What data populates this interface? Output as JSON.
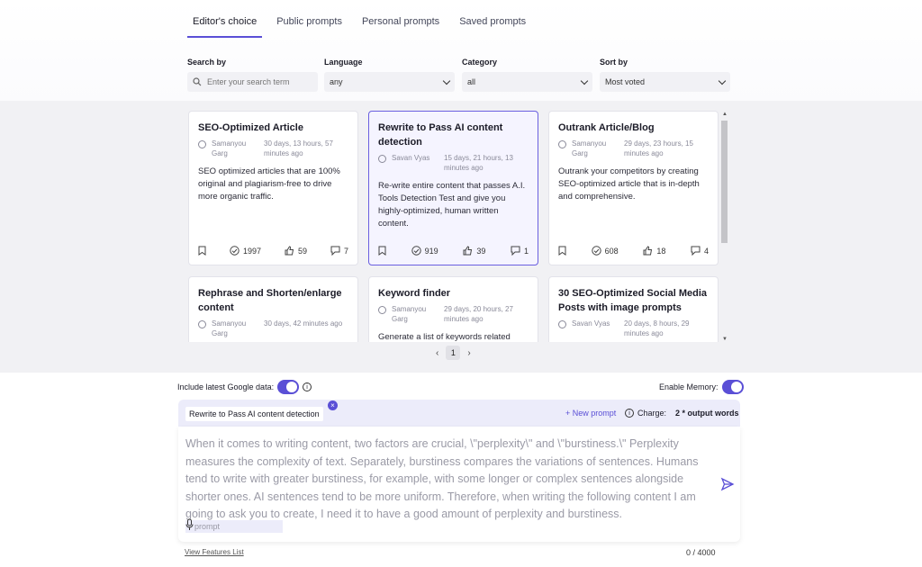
{
  "tabs": [
    {
      "label": "Editor's choice",
      "active": true
    },
    {
      "label": "Public prompts",
      "active": false
    },
    {
      "label": "Personal prompts",
      "active": false
    },
    {
      "label": "Saved prompts",
      "active": false
    }
  ],
  "filters": {
    "search": {
      "label": "Search by",
      "placeholder": "Enter your search term"
    },
    "language": {
      "label": "Language",
      "value": "any"
    },
    "category": {
      "label": "Category",
      "value": "all"
    },
    "sort": {
      "label": "Sort by",
      "value": "Most voted"
    }
  },
  "cards": [
    {
      "title": "SEO-Optimized Article",
      "author": "Samanyou Garg",
      "time": "30 days, 13 hours, 57 minutes ago",
      "description": "SEO optimized articles that are 100% original and plagiarism-free to drive more organic traffic.",
      "views": "1997",
      "likes": "59",
      "comments": "7",
      "selected": false
    },
    {
      "title": "Rewrite to Pass AI content detection",
      "author": "Savan Vyas",
      "time": "15 days, 21 hours, 13 minutes ago",
      "description": "Re-write entire content that passes A.I. Tools Detection Test and give you highly-optimized, human written content.",
      "views": "919",
      "likes": "39",
      "comments": "1",
      "selected": true
    },
    {
      "title": "Outrank Article/Blog",
      "author": "Samanyou Garg",
      "time": "29 days, 23 hours, 15 minutes ago",
      "description": "Outrank your competitors by creating SEO-optimized article that is in-depth and comprehensive.",
      "views": "608",
      "likes": "18",
      "comments": "4",
      "selected": false
    },
    {
      "title": "Rephrase and Shorten/enlarge content",
      "author": "Samanyou Garg",
      "time": "30 days, 42 minutes ago",
      "description": "",
      "views": "",
      "likes": "",
      "comments": "",
      "selected": false
    },
    {
      "title": "Keyword finder",
      "author": "Samanyou Garg",
      "time": "29 days, 20 hours, 27 minutes ago",
      "description": "Generate a list of keywords related",
      "views": "",
      "likes": "",
      "comments": "",
      "selected": false
    },
    {
      "title": "30 SEO-Optimized Social Media Posts with image prompts",
      "author": "Savan Vyas",
      "time": "20 days, 8 hours, 29 minutes ago",
      "description": "",
      "views": "",
      "likes": "",
      "comments": "",
      "selected": false
    }
  ],
  "pager": {
    "prev": "‹",
    "page": "1",
    "next": "›"
  },
  "options": {
    "google_label": "Include latest Google data:",
    "memory_label": "Enable Memory:"
  },
  "prompt": {
    "selected_chip": "Rewrite to Pass AI content detection",
    "new_prompt": "+ New prompt",
    "charge_label": "Charge:",
    "charge_value": "2 * output words",
    "text": "When it comes to writing content, two factors are crucial, \\\"perplexity\\\" and \\\"burstiness.\\\" Perplexity measures the complexity of text. Separately, burstiness compares the variations of sentences. Humans tend to write with greater burstiness, for example, with some longer or complex sentences alongside shorter ones. AI sentences tend to be more uniform. Therefore, when writing the following content I am going to ask you to create, I need it to have a good amount of perplexity and burstiness.",
    "mic_placeholder": "prompt"
  },
  "footer": {
    "features_link": "View Features List",
    "counter": "0 / 4000"
  },
  "colors": {
    "accent": "#5a4fd6"
  }
}
